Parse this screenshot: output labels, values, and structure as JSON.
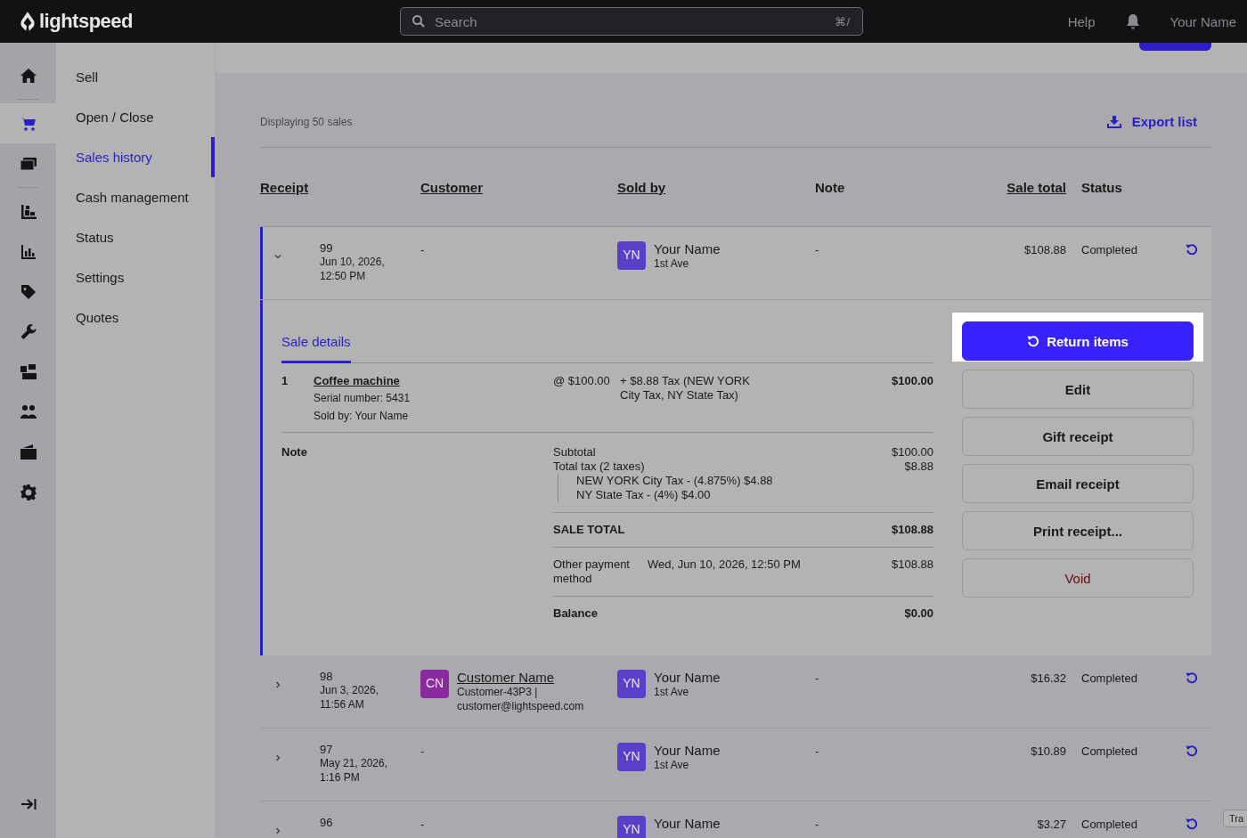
{
  "brand": "lightspeed",
  "search": {
    "placeholder": "Search",
    "shortcut": "⌘/"
  },
  "top_links": {
    "help": "Help",
    "user": "Your Name"
  },
  "rail": {
    "groups": [
      [
        {
          "kind": "home",
          "selected": false
        }
      ],
      [
        {
          "kind": "cart",
          "selected": true
        },
        {
          "kind": "register",
          "selected": false
        }
      ],
      [
        {
          "kind": "inventory",
          "selected": false
        },
        {
          "kind": "chart",
          "selected": false
        },
        {
          "kind": "tag",
          "selected": false
        },
        {
          "kind": "wrench",
          "selected": false
        },
        {
          "kind": "boxes",
          "selected": false
        },
        {
          "kind": "people",
          "selected": false
        },
        {
          "kind": "wallet",
          "selected": false
        },
        {
          "kind": "gear",
          "selected": false
        }
      ]
    ],
    "bottom": {
      "kind": "collapse"
    }
  },
  "nav": [
    {
      "label": "Sell",
      "selected": false
    },
    {
      "label": "Open / Close",
      "selected": false
    },
    {
      "label": "Sales history",
      "selected": true
    },
    {
      "label": "Cash management",
      "selected": false
    },
    {
      "label": "Status",
      "selected": false
    },
    {
      "label": "Settings",
      "selected": false
    },
    {
      "label": "Quotes",
      "selected": false
    }
  ],
  "count": "Displaying 50 sales",
  "export": "Export list",
  "columns": [
    {
      "label": "Receipt",
      "sortable": true
    },
    {
      "label": "Customer",
      "sortable": true
    },
    {
      "label": "Sold by",
      "sortable": true
    },
    {
      "label": "Note",
      "sortable": false
    },
    {
      "label": "Sale total",
      "sortable": true
    },
    {
      "label": "Status",
      "sortable": false
    }
  ],
  "rows": [
    {
      "expanded": true,
      "receipt": "99",
      "date": "Jun 10, 2026,",
      "time": "12:50 PM",
      "customer": {
        "kind": "none",
        "text": "-"
      },
      "sold_by": {
        "initials": "YN",
        "color": "#5a3fc9",
        "name": "Your Name",
        "location": "1st Ave"
      },
      "note": "-",
      "total": "$108.88",
      "status": "Completed"
    },
    {
      "expanded": false,
      "receipt": "98",
      "date": "Jun 3, 2026,",
      "time": "11:56 AM",
      "customer": {
        "kind": "person",
        "initials": "CN",
        "color": "#892b9e",
        "name": "Customer Name",
        "code": "Customer-43P3 |",
        "email": "customer@lightspeed.com"
      },
      "sold_by": {
        "initials": "YN",
        "color": "#5a3fc9",
        "name": "Your Name",
        "location": "1st Ave"
      },
      "note": "-",
      "total": "$16.32",
      "status": "Completed"
    },
    {
      "expanded": false,
      "receipt": "97",
      "date": "May 21, 2026,",
      "time": "1:16 PM",
      "customer": {
        "kind": "none",
        "text": "-"
      },
      "sold_by": {
        "initials": "YN",
        "color": "#5a3fc9",
        "name": "Your Name",
        "location": "1st Ave"
      },
      "note": "-",
      "total": "$10.89",
      "status": "Completed"
    },
    {
      "expanded": false,
      "receipt": "96",
      "customer": {
        "kind": "none",
        "text": "-"
      },
      "sold_by": {
        "initials": "YN",
        "color": "#5a3fc9",
        "name": "Your Name"
      },
      "note": "-",
      "total": "$3.27",
      "status": "Completed"
    }
  ],
  "details": {
    "tab": "Sale details",
    "line_item": {
      "qty": "1",
      "name": "Coffee machine",
      "serial": "Serial number: 5431",
      "sold_by": "Sold by: Your Name",
      "price": "@ $100.00",
      "tax": "+ $8.88 Tax (NEW YORK City Tax, NY State Tax)",
      "amount": "$100.00"
    },
    "note_label": "Note",
    "subtotal": {
      "label": "Subtotal",
      "value": "$100.00"
    },
    "total_tax": {
      "label": "Total tax (2 taxes)",
      "value": "$8.88"
    },
    "tax_lines": [
      "NEW YORK City Tax - (4.875%) $4.88",
      "NY State Tax - (4%) $4.00"
    ],
    "sale_total": {
      "label": "SALE TOTAL",
      "value": "$108.88"
    },
    "payment": {
      "method": "Other payment method",
      "date": "Wed, Jun 10, 2026, 12:50 PM",
      "value": "$108.88"
    },
    "balance": {
      "label": "Balance",
      "value": "$0.00"
    }
  },
  "actions": [
    {
      "label": "Return items",
      "kind": "primary",
      "highlighted": true
    },
    {
      "label": "Edit",
      "kind": "default",
      "highlighted": false
    },
    {
      "label": "Gift receipt",
      "kind": "default",
      "highlighted": false
    },
    {
      "label": "Email receipt",
      "kind": "default",
      "highlighted": false
    },
    {
      "label": "Print receipt...",
      "kind": "default",
      "highlighted": false
    },
    {
      "label": "Void",
      "kind": "danger",
      "highlighted": false
    }
  ],
  "corner_tab": "Tra"
}
